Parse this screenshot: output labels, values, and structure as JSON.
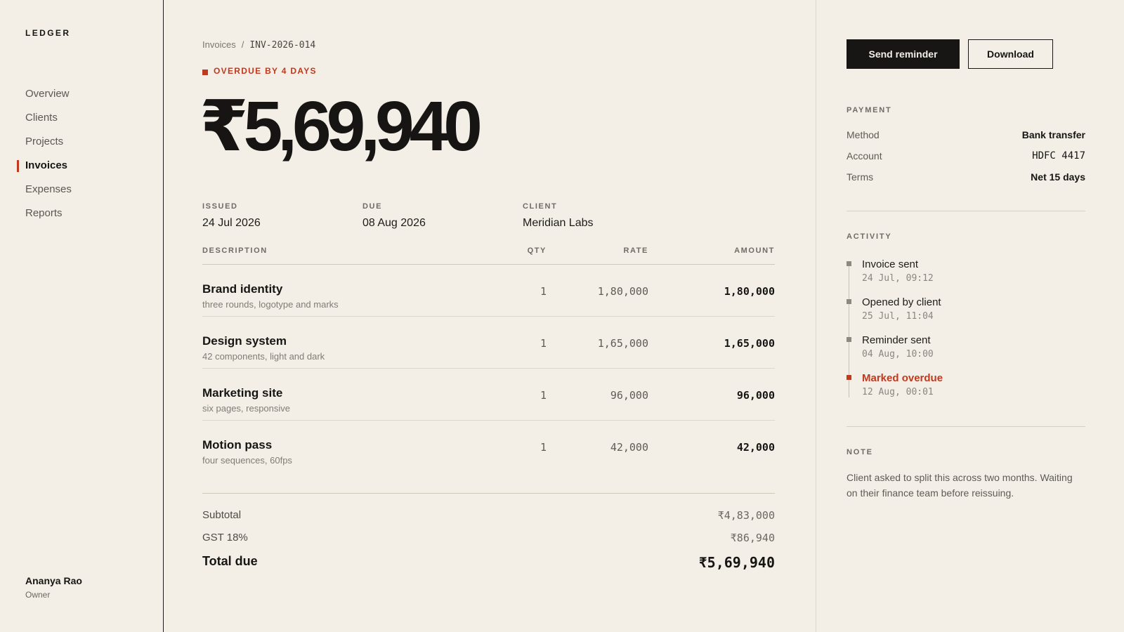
{
  "sidebar": {
    "brand": "LEDGER",
    "nav": [
      "Overview",
      "Clients",
      "Projects",
      "Invoices",
      "Expenses",
      "Reports"
    ],
    "active_index": 3,
    "user": {
      "name": "Ananya Rao",
      "role": "Owner"
    }
  },
  "main": {
    "breadcrumb": {
      "parent": "Invoices",
      "separator": "/",
      "current": "INV-2026-014"
    },
    "status": "OVERDUE BY 4 DAYS",
    "hero_amount": "₹5,69,940",
    "meta": [
      {
        "label": "ISSUED",
        "value": "24 Jul 2026"
      },
      {
        "label": "DUE",
        "value": "08 Aug 2026"
      },
      {
        "label": "CLIENT",
        "value": "Meridian Labs"
      }
    ],
    "table": {
      "headers": {
        "description": "DESCRIPTION",
        "qty": "QTY",
        "rate": "RATE",
        "amount": "AMOUNT"
      },
      "rows": [
        {
          "title": "Brand identity",
          "sub": "three rounds, logotype and marks",
          "qty": "1",
          "rate": "1,80,000",
          "amount": "1,80,000"
        },
        {
          "title": "Design system",
          "sub": "42 components, light and dark",
          "qty": "1",
          "rate": "1,65,000",
          "amount": "1,65,000"
        },
        {
          "title": "Marketing site",
          "sub": "six pages, responsive",
          "qty": "1",
          "rate": "96,000",
          "amount": "96,000"
        },
        {
          "title": "Motion pass",
          "sub": "four sequences, 60fps",
          "qty": "1",
          "rate": "42,000",
          "amount": "42,000"
        }
      ]
    },
    "totals": {
      "subtotal_label": "Subtotal",
      "subtotal": "₹4,83,000",
      "gst_label": "GST 18%",
      "gst": "₹86,940",
      "total_label": "Total due",
      "total": "₹5,69,940"
    }
  },
  "panel": {
    "send_reminder": "Send reminder",
    "download": "Download",
    "payment": {
      "label": "PAYMENT",
      "method_k": "Method",
      "method_v": "Bank transfer",
      "account_k": "Account",
      "account_v": "HDFC 4417",
      "terms_k": "Terms",
      "terms_v": "Net 15 days"
    },
    "activity": {
      "label": "ACTIVITY",
      "events": [
        {
          "title": "Invoice sent",
          "time": "24 Jul, 09:12"
        },
        {
          "title": "Opened by client",
          "time": "25 Jul, 11:04"
        },
        {
          "title": "Reminder sent",
          "time": "04 Aug, 10:00"
        },
        {
          "title": "Marked overdue",
          "time": "12 Aug, 00:01"
        }
      ]
    },
    "note": {
      "label": "NOTE",
      "text": "Client asked to split this across two months. Waiting on their finance team before reissuing."
    }
  },
  "colors": {
    "accent": "#c0391f",
    "background": "#f3efe6",
    "ink": "#161513"
  }
}
